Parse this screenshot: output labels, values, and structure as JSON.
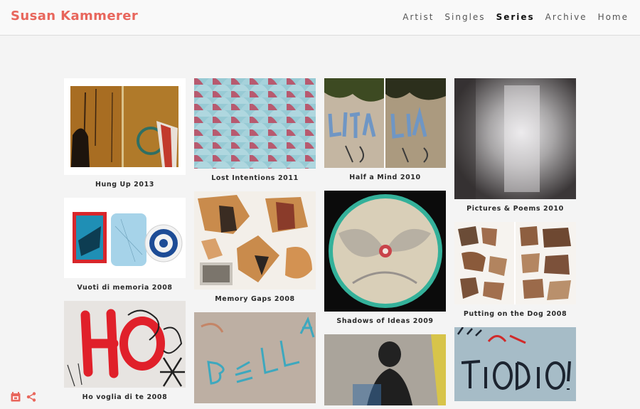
{
  "site": {
    "title": "Susan Kammerer"
  },
  "nav": [
    {
      "label": "Artist",
      "active": false
    },
    {
      "label": "Singles",
      "active": false
    },
    {
      "label": "Series",
      "active": true
    },
    {
      "label": "Archive",
      "active": false
    },
    {
      "label": "Home",
      "active": false
    }
  ],
  "gallery": [
    {
      "title": "Hung Up 2013"
    },
    {
      "title": "Vuoti di memoria 2008"
    },
    {
      "title": "Ho voglia di te 2008"
    },
    {
      "title": "Lost Intentions 2011"
    },
    {
      "title": "Memory Gaps 2008"
    },
    {
      "title": "Half a Mind 2010"
    },
    {
      "title": "Shadows of Ideas 2009"
    },
    {
      "title": "Pictures & Poems 2010"
    },
    {
      "title": "Putting on the Dog 2008"
    }
  ],
  "icons": {
    "footer_left": "calendar-icon",
    "footer_right": "share-icon",
    "accent": "#e8665c"
  }
}
